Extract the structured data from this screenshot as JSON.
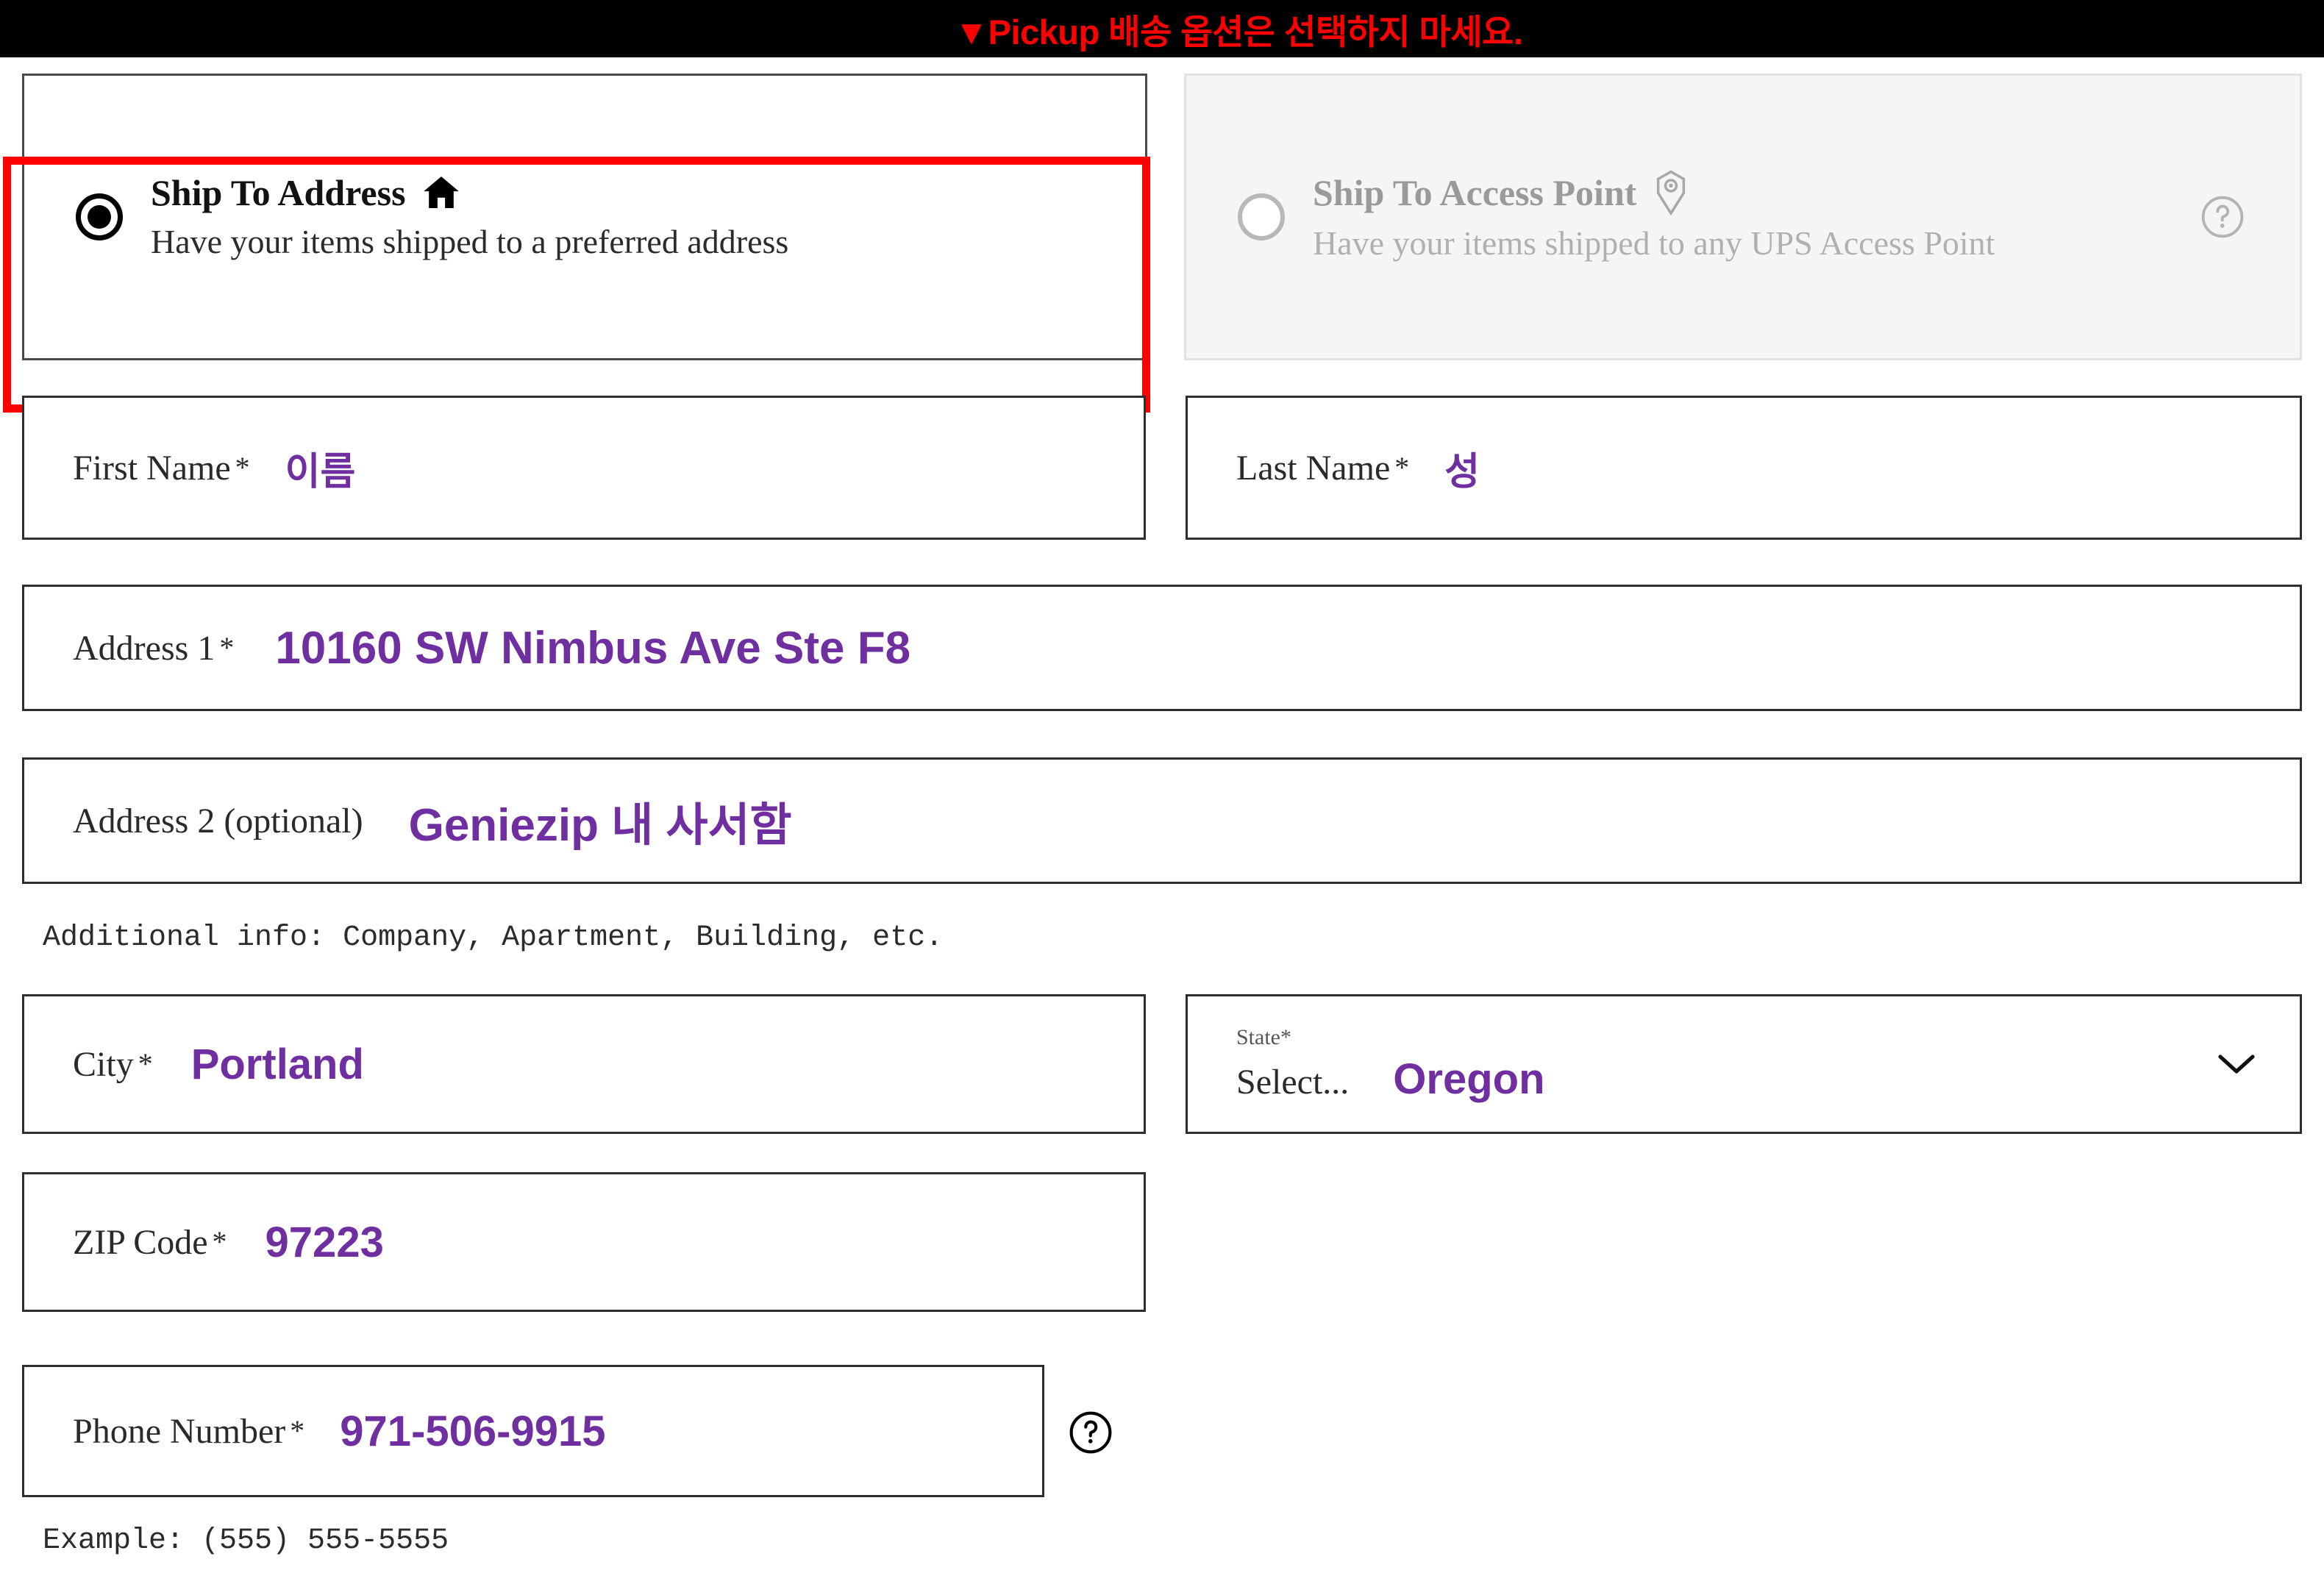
{
  "banner": {
    "text": "▼Pickup 배송 옵션은 선택하지 마세요."
  },
  "shipping_options": {
    "selected": "ship-to-address",
    "items": [
      {
        "id": "ship-to-address",
        "title": "Ship To Address",
        "description": "Have your items shipped to a preferred address",
        "icon": "home-icon",
        "selected": true,
        "disabled": false,
        "highlighted": true
      },
      {
        "id": "ship-to-access-point",
        "title": "Ship To Access Point",
        "description": "Have your items shipped to any UPS Access Point",
        "icon": "map-pin-icon",
        "help_icon": "question-circle-icon",
        "selected": false,
        "disabled": true,
        "highlighted": false
      }
    ]
  },
  "form": {
    "first_name": {
      "label": "First Name",
      "required_mark": "*",
      "annotation": "이름"
    },
    "last_name": {
      "label": "Last Name",
      "required_mark": "*",
      "annotation": "성"
    },
    "address1": {
      "label": "Address 1",
      "required_mark": "*",
      "annotation": "10160 SW Nimbus Ave Ste F8"
    },
    "address2": {
      "label": "Address 2 (optional)",
      "required_mark": "",
      "annotation": "Geniezip 내 사서함",
      "helper": "Additional info: Company, Apartment, Building, etc."
    },
    "city": {
      "label": "City",
      "required_mark": "*",
      "annotation": "Portland"
    },
    "state": {
      "label": "State",
      "required_mark": "*",
      "placeholder": "Select...",
      "annotation": "Oregon"
    },
    "zip": {
      "label": "ZIP Code",
      "required_mark": "*",
      "annotation": "97223"
    },
    "phone": {
      "label": "Phone Number",
      "required_mark": "*",
      "annotation": "971-506-9915",
      "helper": "Example: (555) 555-5555",
      "help_icon": "question-circle-icon"
    }
  },
  "colors": {
    "annotation_purple": "#6f2fa0",
    "warning_red": "#ff0000",
    "banner_background": "#000000",
    "disabled_grey": "#b0b0b0"
  }
}
